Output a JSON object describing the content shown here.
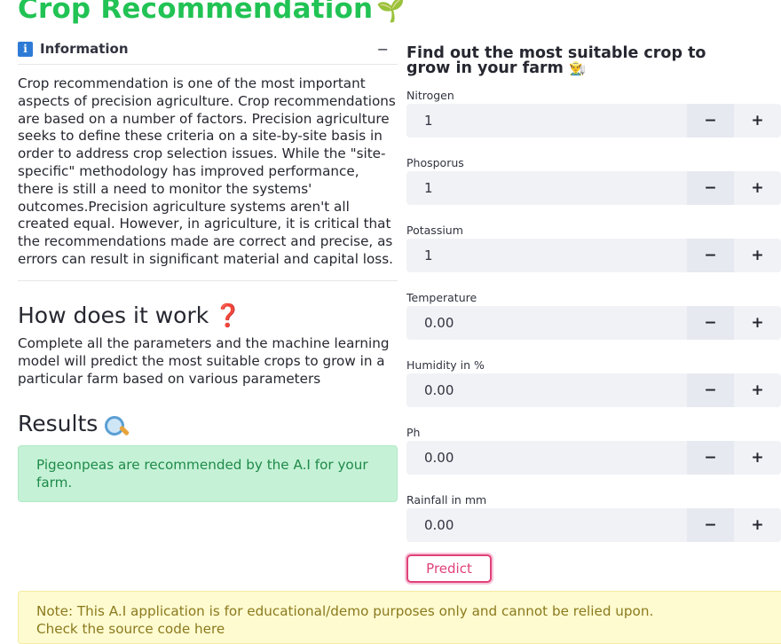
{
  "page": {
    "title": "Crop Recommendation",
    "title_emoji": "🌱"
  },
  "info": {
    "label": "Information",
    "icon": "info-icon",
    "collapse_symbol": "−",
    "body": "Crop recommendation is one of the most important aspects of precision agriculture. Crop recommendations are based on a number of factors. Precision agriculture seeks to define these criteria on a site-by-site basis in order to address crop selection issues. While the \"site-specific\" methodology has improved performance, there is still a need to monitor the systems' outcomes.Precision agriculture systems aren't all created equal. However, in agriculture, it is critical that the recommendations made are correct and precise, as errors can result in significant material and capital loss."
  },
  "how": {
    "heading": "How does it work",
    "heading_mark": "❓",
    "text": "Complete all the parameters and the machine learning model will predict the most suitable crops to grow in a particular farm based on various parameters"
  },
  "results": {
    "heading": "Results",
    "icon": "magnifier-icon",
    "message": "Pigeonpeas are recommended by the A.I for your farm."
  },
  "form": {
    "heading_line1": "Find out the most suitable crop to",
    "heading_line2": "grow in your farm",
    "heading_emoji": "👨‍🌾",
    "fields": [
      {
        "label": "Nitrogen",
        "value": "1"
      },
      {
        "label": "Phosporus",
        "value": "1"
      },
      {
        "label": "Potassium",
        "value": "1"
      },
      {
        "label": "Temperature",
        "value": "0.00"
      },
      {
        "label": "Humidity in %",
        "value": "0.00"
      },
      {
        "label": "Ph",
        "value": "0.00"
      },
      {
        "label": "Rainfall in mm",
        "value": "0.00"
      }
    ],
    "minus": "−",
    "plus": "+",
    "predict_label": "Predict"
  },
  "note": {
    "line1": "Note: This A.I application is for educational/demo purposes only and cannot be relied upon.",
    "line2": "Check the source code here"
  },
  "colors": {
    "title_green": "#21c354",
    "accent_pink": "#e0417a",
    "success_bg": "#c5f2d6",
    "warning_bg": "#fffbd0"
  }
}
